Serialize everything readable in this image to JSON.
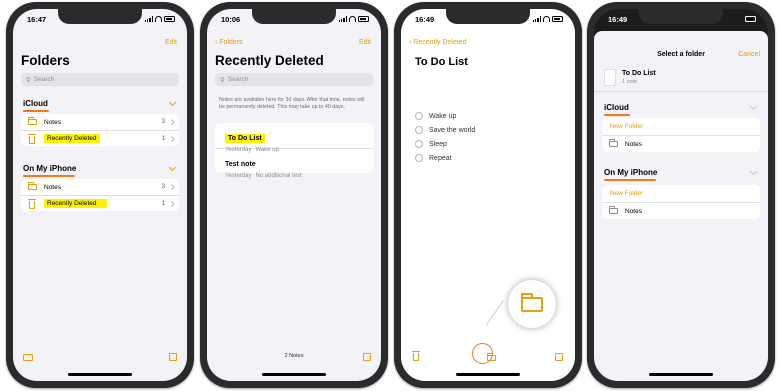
{
  "phone1": {
    "time": "16:47",
    "edit": "Edit",
    "title": "Folders",
    "search_placeholder": "Search",
    "sections": [
      {
        "title": "iCloud",
        "items": [
          {
            "label": "Notes",
            "count": "3"
          },
          {
            "label": "Recently Deleted",
            "count": "1"
          }
        ]
      },
      {
        "title": "On My iPhone",
        "items": [
          {
            "label": "Notes",
            "count": "3"
          },
          {
            "label": "Recently Deleted",
            "count": "1"
          }
        ]
      }
    ]
  },
  "phone2": {
    "time": "10:06",
    "back": "Folders",
    "edit": "Edit",
    "title": "Recently Deleted",
    "search_placeholder": "Search",
    "info": "Notes are available here for 30 days. After that time, notes will be permanently deleted. This may take up to 40 days.",
    "notes": [
      {
        "title": "To Do List",
        "date": "Yesterday",
        "preview": "Wake up"
      },
      {
        "title": "Test note",
        "date": "Yesterday",
        "preview": "No additional text"
      }
    ],
    "footer": "2 Notes"
  },
  "phone3": {
    "time": "16:49",
    "back": "Recently Deleted",
    "title": "To Do List",
    "checklist": [
      "Wake up",
      "Save the world",
      "Sleep",
      "Repeat"
    ]
  },
  "phone4": {
    "time": "16:49",
    "sheet_title": "Select a folder",
    "cancel": "Cancel",
    "preview_title": "To Do List",
    "preview_sub": "1 note",
    "sections": [
      {
        "title": "iCloud",
        "new_folder": "New Folder",
        "folder": "Notes"
      },
      {
        "title": "On My iPhone",
        "new_folder": "New Folder",
        "folder": "Notes"
      }
    ]
  },
  "colors": {
    "accent": "#e2a20b",
    "annotation": "#f07b1c",
    "highlight": "#fff200"
  }
}
